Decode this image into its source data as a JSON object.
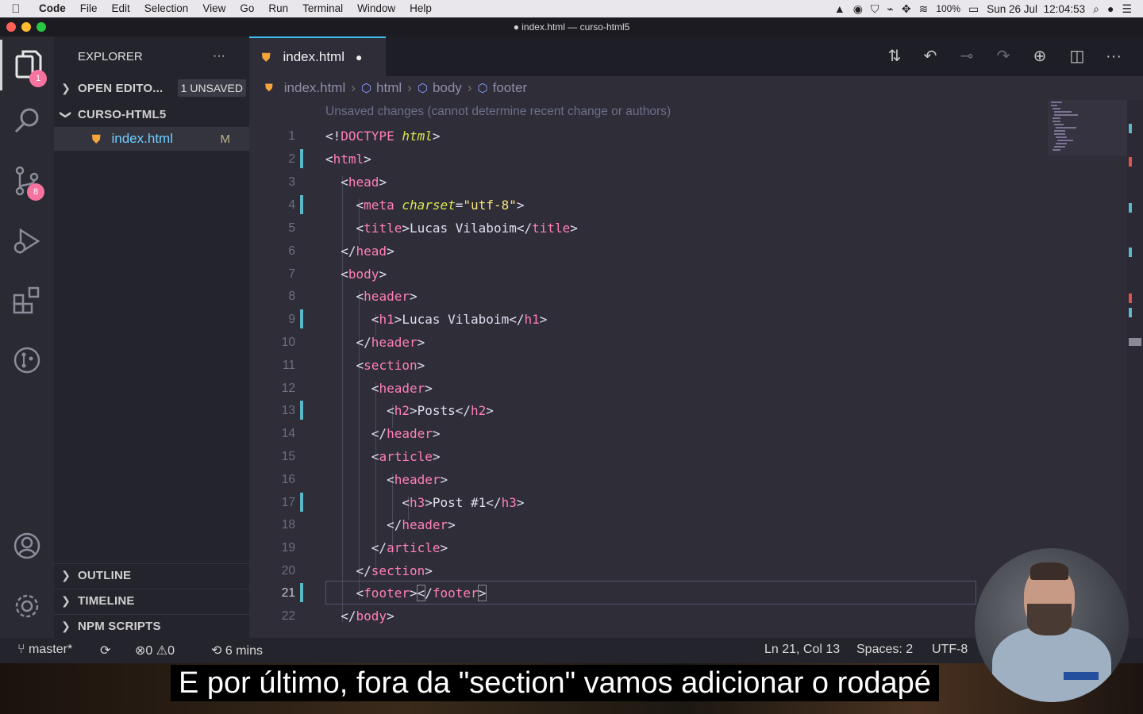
{
  "menubar": {
    "app_name": "Code",
    "items": [
      "File",
      "Edit",
      "Selection",
      "View",
      "Go",
      "Run",
      "Terminal",
      "Window",
      "Help"
    ],
    "battery": "100%",
    "clock": "Sun 26 Jul  12:04:53"
  },
  "window": {
    "title": "● index.html — curso-html5"
  },
  "activity": {
    "explorer_badge": "1",
    "scm_badge": "8"
  },
  "sidebar": {
    "title": "EXPLORER",
    "more": "···",
    "open_editors": "OPEN EDITO...",
    "unsaved_tag": "1 UNSAVED",
    "folder": "CURSO-HTML5",
    "file_name": "index.html",
    "file_status": "M",
    "outline": "OUTLINE",
    "timeline": "TIMELINE",
    "npm_scripts": "NPM SCRIPTS"
  },
  "tabs": {
    "active_label": "index.html",
    "dirty_dot": "●"
  },
  "breadcrumb": [
    "index.html",
    "html",
    "body",
    "footer"
  ],
  "editor": {
    "codelens": "Unsaved changes (cannot determine recent change or authors)",
    "line_numbers": [
      "1",
      "2",
      "3",
      "4",
      "5",
      "6",
      "7",
      "8",
      "9",
      "10",
      "11",
      "12",
      "13",
      "14",
      "15",
      "16",
      "17",
      "18",
      "19",
      "20",
      "21",
      "22"
    ]
  },
  "statusbar": {
    "branch": "master*",
    "errors": "0",
    "warnings": "0",
    "time": "6 mins",
    "position": "Ln 21, Col 13",
    "spaces": "Spaces: 2",
    "encoding": "UTF-8"
  },
  "subtitle": "E por último, fora da \"section\" vamos adicionar o rodapé",
  "colors": {
    "accent": "#3ec2f5",
    "badge": "#f7739f",
    "tag": "#ff80b5",
    "attr": "#dde54f",
    "string": "#f8e57c"
  },
  "icons": [
    "apple-icon",
    "files-icon",
    "search-icon",
    "source-control-icon",
    "run-debug-icon",
    "extensions-icon",
    "git-graph-icon",
    "account-icon",
    "settings-icon",
    "html5-file-icon"
  ]
}
